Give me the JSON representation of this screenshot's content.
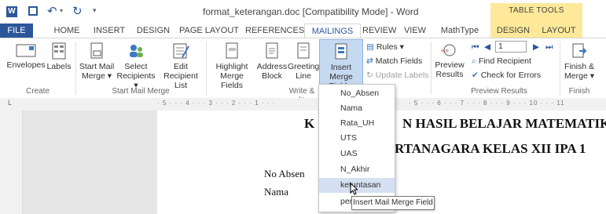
{
  "window": {
    "title": "format_keterangan.doc [Compatibility Mode] - Word",
    "context_tab_group": "TABLE TOOLS"
  },
  "tabs": [
    "FILE",
    "HOME",
    "INSERT",
    "DESIGN",
    "PAGE LAYOUT",
    "REFERENCES",
    "MAILINGS",
    "REVIEW",
    "VIEW",
    "MathType",
    "DESIGN",
    "LAYOUT"
  ],
  "ribbon": {
    "create": {
      "label": "Create",
      "envelopes": "Envelopes",
      "labels": "Labels"
    },
    "start_mail_merge": {
      "label": "Start Mail Merge",
      "start_1": "Start Mail",
      "start_2": "Merge ▾",
      "select_1": "Select",
      "select_2": "Recipients ▾",
      "edit_1": "Edit",
      "edit_2": "Recipient List"
    },
    "write_insert": {
      "label": "Write & In",
      "highlight_1": "Highlight",
      "highlight_2": "Merge Fields",
      "address_1": "Address",
      "address_2": "Block",
      "greeting_1": "Greeting",
      "greeting_2": "Line",
      "insert_1": "Insert Merge",
      "insert_2": "Field ▾",
      "rules": "Rules ▾",
      "match": "Match Fields",
      "update": "Update Labels"
    },
    "preview_results": {
      "label": "Preview Results",
      "preview_1": "Preview",
      "preview_2": "Results",
      "record_value": "1",
      "find": "Find Recipient",
      "check": "Check for Errors"
    },
    "finish": {
      "label": "Finish",
      "finish_1": "Finish &",
      "finish_2": "Merge ▾"
    }
  },
  "ruler": {
    "marks": "· 5 · · · 4 · · · 3 · · · 2 · · · 1 · · ·",
    "marks_right": "· 5 · · · 6 · · · 7 · · · 8 · · · 9 · · · 10 · · · 11"
  },
  "document": {
    "heading_1_left": "K",
    "heading_1_right": "N HASIL BELAJAR MATEMATIKA",
    "heading_2_right": "RTANAGARA KELAS XII IPA 1",
    "line_1": "No Absen",
    "line_2": "Nama"
  },
  "merge_field_menu": {
    "items": [
      "No_Absen",
      "Nama",
      "Rata_UH",
      "UTS",
      "UAS",
      "N_Akhir",
      "ketuntasan",
      "per"
    ],
    "highlighted_index": 6
  },
  "tooltip": "Insert Mail Merge Field",
  "colors": {
    "word_blue": "#2b579a",
    "context_yellow": "#fde999",
    "hover": "#d5e1f2"
  }
}
